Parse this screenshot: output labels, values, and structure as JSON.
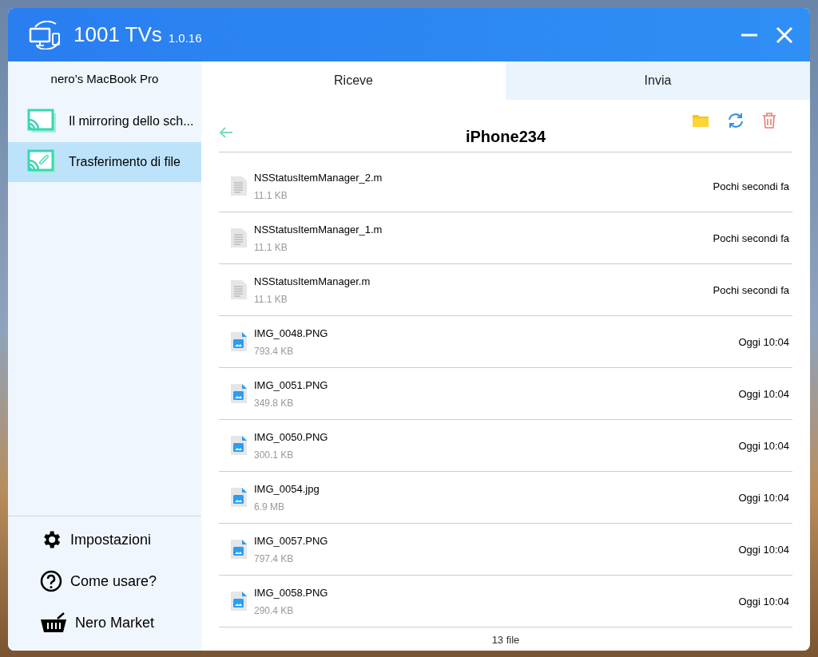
{
  "window": {
    "title": "1001 TVs",
    "version": "1.0.16"
  },
  "sidebar": {
    "device": "nero’s MacBook Pro",
    "items": [
      {
        "label": "Il mirroring dello sch...",
        "kind": "mirror",
        "selected": false
      },
      {
        "label": "Trasferimento di file",
        "kind": "transfer",
        "selected": true
      }
    ],
    "bottom_items": [
      {
        "label": "Impostazioni",
        "kind": "settings"
      },
      {
        "label": "Come usare?",
        "kind": "help"
      },
      {
        "label": "Nero Market",
        "kind": "market"
      }
    ]
  },
  "tabs": [
    {
      "label": "Riceve",
      "selected": true
    },
    {
      "label": "Invia",
      "selected": false
    }
  ],
  "folder": {
    "title": "iPhone234"
  },
  "files": [
    {
      "name": "NSStatusItemManager_2.m",
      "size": "11.1 KB",
      "time": "Pochi secondi fa",
      "kind": "text"
    },
    {
      "name": "NSStatusItemManager_1.m",
      "size": "11.1 KB",
      "time": "Pochi secondi fa",
      "kind": "text"
    },
    {
      "name": "NSStatusItemManager.m",
      "size": "11.1 KB",
      "time": "Pochi secondi fa",
      "kind": "text"
    },
    {
      "name": "IMG_0048.PNG",
      "size": "793.4 KB",
      "time": "Oggi 10:04",
      "kind": "image"
    },
    {
      "name": "IMG_0051.PNG",
      "size": "349.8 KB",
      "time": "Oggi 10:04",
      "kind": "image"
    },
    {
      "name": "IMG_0050.PNG",
      "size": "300.1 KB",
      "time": "Oggi 10:04",
      "kind": "image"
    },
    {
      "name": "IMG_0054.jpg",
      "size": "6.9 MB",
      "time": "Oggi 10:04",
      "kind": "image"
    },
    {
      "name": "IMG_0057.PNG",
      "size": "797.4 KB",
      "time": "Oggi 10:04",
      "kind": "image"
    },
    {
      "name": "IMG_0058.PNG",
      "size": "290.4 KB",
      "time": "Oggi 10:04",
      "kind": "image"
    }
  ],
  "footer": "13 file"
}
